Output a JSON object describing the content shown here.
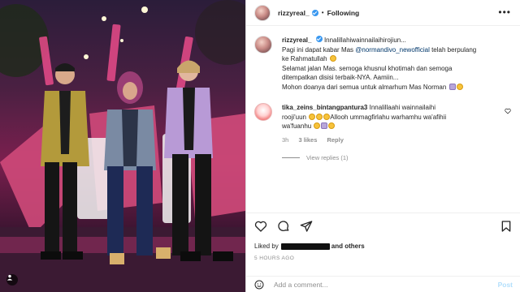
{
  "post": {
    "username": "rizzyreal_",
    "follow_status": "Following",
    "caption": {
      "username": "rizzyreal_",
      "line1": "Innalillahiwainnailaihirojiun...",
      "line2_prefix": "Pagi ini dapat kabar Mas ",
      "line2_mention": "@normandivo_newofficial",
      "line2_suffix": " telah berpulang",
      "line3": "ke Rahmatullah",
      "line4": "Selamat jalan Mas. semoga khusnul khotimah dan semoga",
      "line5": "ditempatkan disisi terbaik-NYA. Aamiin...",
      "line6": "Mohon doanya dari semua untuk almarhum Mas Norman"
    },
    "comment": {
      "username": "tika_zeins_bintangpantura3",
      "text1": "Innalillaahi wainnailaihi",
      "text2": "rooji'uun",
      "text3": "Allooh ummagfirlahu warhamhu wa'afihii",
      "text4": "wa'fuanhu",
      "age": "3h",
      "likes": "3 likes",
      "reply_label": "Reply"
    },
    "view_replies": "View replies (1)",
    "liked_by_prefix": "Liked by",
    "liked_by_suffix": "and others",
    "timestamp": "5 HOURS AGO",
    "add_comment_placeholder": "Add a comment...",
    "post_button": "Post"
  },
  "icons": [
    "more-icon",
    "heart-icon",
    "comment-icon",
    "share-icon",
    "bookmark-icon",
    "emoji-icon",
    "verified-icon",
    "tagged-user-icon"
  ],
  "colors": {
    "verified": "#3897f0",
    "mention": "#00376b",
    "muted": "#8e8e8e",
    "post_disabled": "#b2dffc"
  }
}
